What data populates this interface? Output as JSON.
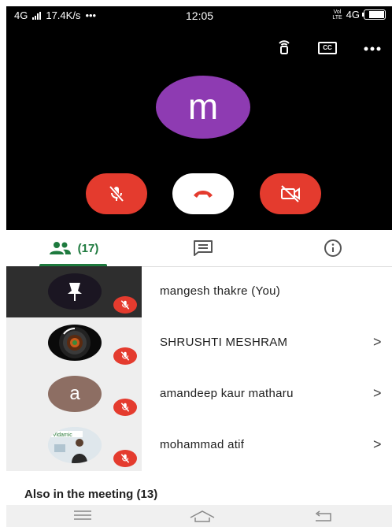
{
  "status_bar": {
    "network": "4G",
    "speed": "17.4K/s",
    "dots": "•••",
    "time": "12:05",
    "volte_top": "Vol",
    "volte_bottom": "LTE",
    "network_right": "4G"
  },
  "call": {
    "self_initial": "m"
  },
  "tabs": {
    "people_count": "(17)"
  },
  "participants": [
    {
      "name": "mangesh thakre (You)"
    },
    {
      "name": "SHRUSHTI MESHRAM"
    },
    {
      "name": "amandeep kaur matharu",
      "initial": "a"
    },
    {
      "name": "mohammad atif",
      "thumb_text": "Vidamic"
    }
  ],
  "also_in_meeting": "Also in the meeting (13)",
  "chevron": ">",
  "colors": {
    "accent_green": "#1e7a3e",
    "danger_red": "#e43b2e",
    "avatar_purple": "#8e3bb2",
    "avatar_brown": "#8d6e63"
  },
  "icons": [
    "signal-icon",
    "wifi-antenna-icon",
    "captions-icon",
    "more-icon",
    "mic-off-icon",
    "end-call-icon",
    "camera-off-icon",
    "people-icon",
    "chat-icon",
    "info-icon",
    "pin-icon",
    "chevron-right-icon",
    "menu-icon",
    "home-icon",
    "back-icon"
  ]
}
